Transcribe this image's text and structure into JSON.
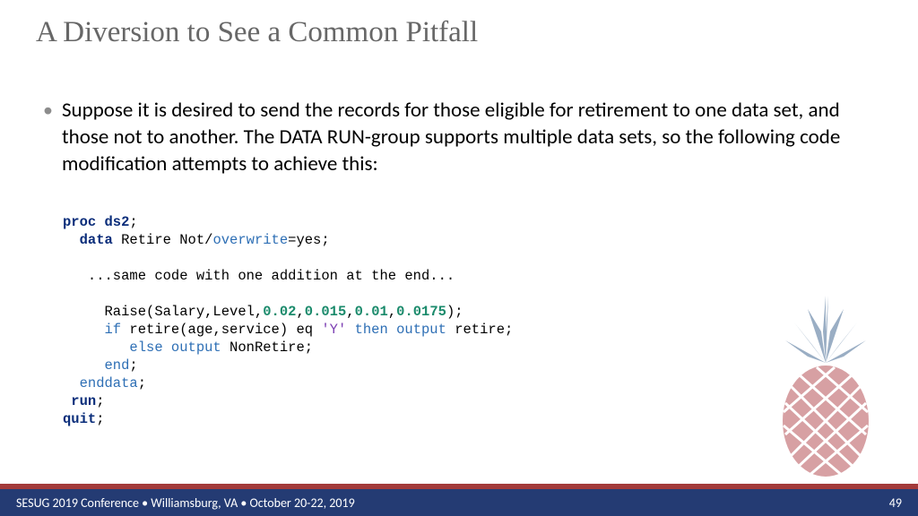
{
  "title": "A Diversion to See a Common Pitfall",
  "bullet": "Suppose it is desired to send the records for those eligible for retirement to one data set, and those not to another. The DATA RUN-group supports multiple data sets, so the following code modification attempts to achieve this:",
  "code": {
    "l1a": "proc ds2",
    "l1b": ";",
    "l2a": "  data",
    "l2b": " Retire Not/",
    "l2c": "overwrite",
    "l2d": "=yes;",
    "l3": "   ...same code with one addition at the end...",
    "l4a": "     Raise(Salary,Level,",
    "l4b": "0.02",
    "l4c": ",",
    "l4d": "0.015",
    "l4e": ",",
    "l4f": "0.01",
    "l4g": ",",
    "l4h": "0.0175",
    "l4i": ");",
    "l5a": "     if",
    "l5b": " retire(age,service) eq ",
    "l5c": "'Y'",
    "l5d": " then output",
    "l5e": " retire;",
    "l6a": "        else output",
    "l6b": " NonRetire;",
    "l7a": "     end",
    "l7b": ";",
    "l8a": "  enddata",
    "l8b": ";",
    "l9a": " run",
    "l9b": ";",
    "l10a": "quit",
    "l10b": ";"
  },
  "footer": {
    "left": "SESUG 2019 Conference • Williamsburg, VA • October 20-22, 2019",
    "right": "49"
  }
}
